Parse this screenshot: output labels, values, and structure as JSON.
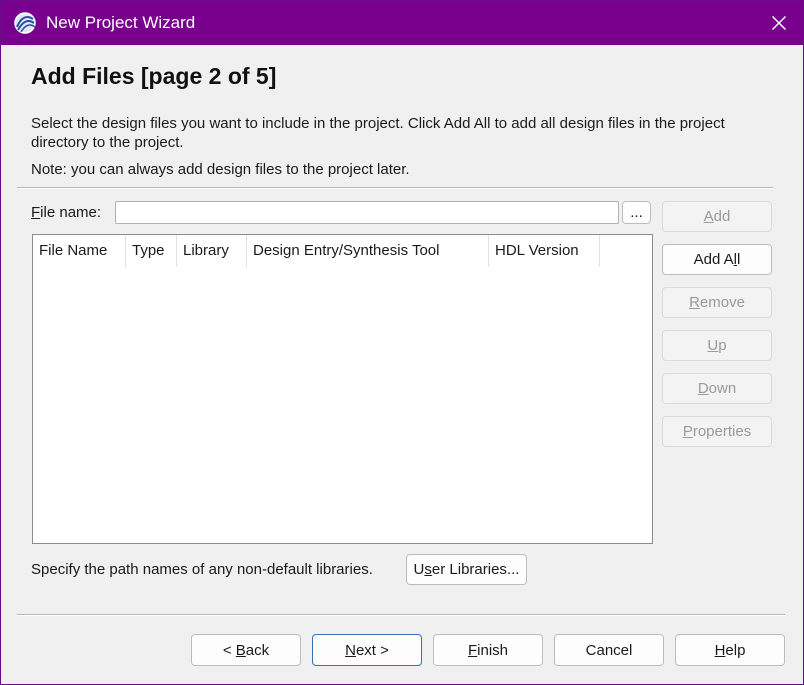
{
  "window": {
    "title": "New Project Wizard"
  },
  "page": {
    "heading": "Add Files [page 2 of 5]",
    "description": "Select the design files you want to include in the project. Click Add All to add all design files in the project directory to the project.",
    "note": "Note: you can always add design files to the project later."
  },
  "file_name": {
    "label_mnemonic": "F",
    "label_rest": "ile name:",
    "value": "",
    "browse_label": "..."
  },
  "table": {
    "columns": [
      "File Name",
      "Type",
      "Library",
      "Design Entry/Synthesis Tool",
      "HDL Version"
    ],
    "rows": []
  },
  "side_buttons": {
    "add": {
      "pre": "",
      "mn": "A",
      "post": "dd"
    },
    "add_all": {
      "pre": "Add A",
      "mn": "l",
      "post": "l"
    },
    "remove": {
      "pre": "",
      "mn": "R",
      "post": "emove"
    },
    "up": {
      "pre": "",
      "mn": "U",
      "post": "p"
    },
    "down": {
      "pre": "",
      "mn": "D",
      "post": "own"
    },
    "properties": {
      "pre": "",
      "mn": "P",
      "post": "roperties"
    }
  },
  "libraries": {
    "text": "Specify the path names of any non-default libraries.",
    "button": {
      "pre": "U",
      "mn": "s",
      "post": "er Libraries..."
    }
  },
  "footer": {
    "back": {
      "pre": "< ",
      "mn": "B",
      "post": "ack"
    },
    "next": {
      "pre": "",
      "mn": "N",
      "post": "ext >"
    },
    "finish": {
      "pre": "",
      "mn": "F",
      "post": "inish"
    },
    "cancel": {
      "pre": "Cancel",
      "mn": "",
      "post": ""
    },
    "help": {
      "pre": "",
      "mn": "H",
      "post": "elp"
    }
  }
}
